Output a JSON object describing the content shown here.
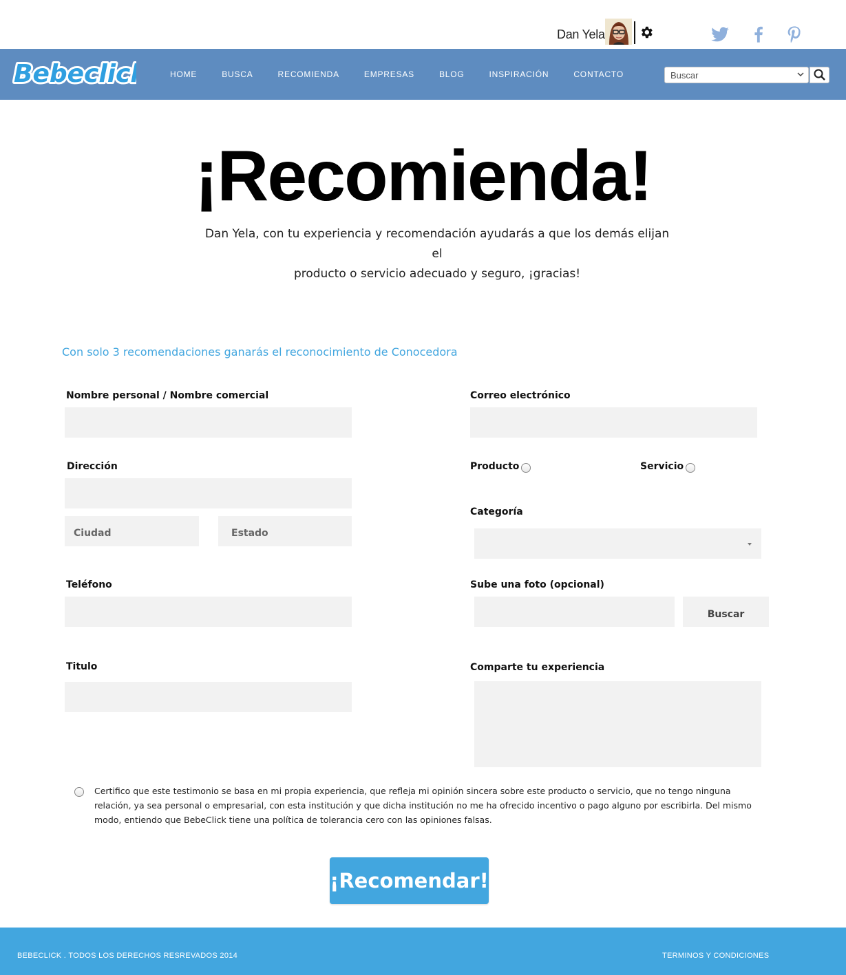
{
  "header": {
    "user_name": "Dan Yela",
    "avatar_icon": "user-avatar",
    "settings_icon": "gear-icon",
    "social": [
      "twitter-icon",
      "facebook-icon",
      "pinterest-icon"
    ]
  },
  "nav": {
    "logo_text": "Bebeclick",
    "items": [
      "HOME",
      "BUSCA",
      "RECOMIENDA",
      "EMPRESAS",
      "BLOG",
      "INSPIRACIÓN",
      "CONTACTO"
    ],
    "search_placeholder": "Buscar"
  },
  "hero": {
    "title": "¡Recomienda!",
    "subtitle_line1": "Dan Yela, con tu experiencia y recomendación ayudarás a que los demás elijan el",
    "subtitle_line2": "producto o servicio adecuado y seguro, ¡gracias!"
  },
  "promo": "Con solo 3 recomendaciones ganarás el reconocimiento de Conocedora",
  "form": {
    "name_label": "Nombre personal / Nombre comercial",
    "email_label": "Correo electrónico",
    "address_label": "Dirección",
    "city_placeholder": "Ciudad",
    "state_placeholder": "Estado",
    "product_label": "Producto",
    "service_label": "Servicio",
    "category_label": "Categoría",
    "phone_label": "Teléfono",
    "photo_label": "Sube una foto (opcional)",
    "browse_button": "Buscar",
    "title_label": "Titulo",
    "experience_label": "Comparte tu experiencia",
    "certify_text": "Certifico que este testimonio se basa en mi propia experiencia, que refleja mi opinión sincera sobre este producto o servicio, que no tengo ninguna relación, ya sea personal o empresarial, con esta institución y que dicha institución no me ha ofrecido incentivo o pago alguno por escribirla. Del mismo modo, entiendo que BebeClick tiene una política de tolerancia cero con las opiniones falsas.",
    "submit": "¡Recomendar!"
  },
  "footer": {
    "copyright": "BEBECLICK . TODOS LOS DERECHOS RESREVADOS 2014",
    "terms": "TERMINOS Y CONDICIONES"
  },
  "colors": {
    "nav_bg": "#5e8cc0",
    "accent": "#42a6df",
    "field_bg": "#f2f2f2"
  }
}
